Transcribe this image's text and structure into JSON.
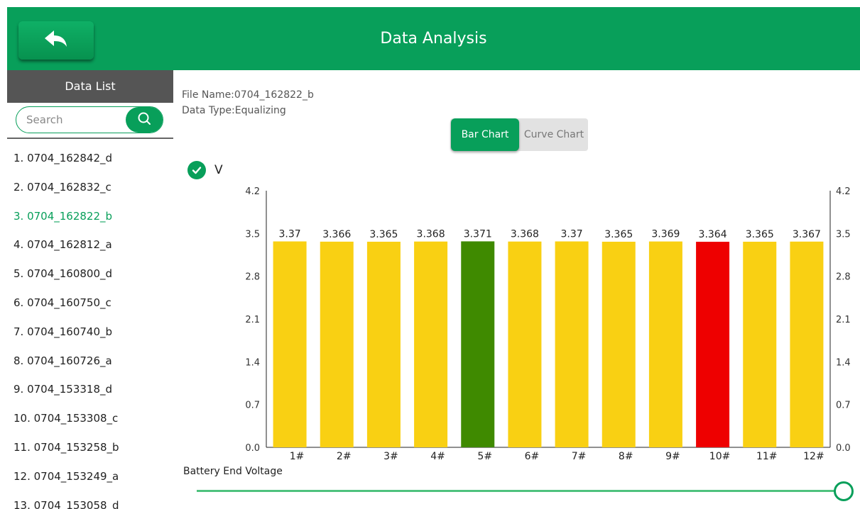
{
  "header": {
    "title": "Data Analysis",
    "back_icon": "back-arrow-icon"
  },
  "sidebar": {
    "title": "Data List",
    "search_placeholder": "Search",
    "items": [
      {
        "label": "1.  0704_162842_d",
        "selected": false
      },
      {
        "label": "2.  0704_162832_c",
        "selected": false
      },
      {
        "label": "3.  0704_162822_b",
        "selected": true
      },
      {
        "label": "4.  0704_162812_a",
        "selected": false
      },
      {
        "label": "5.  0704_160800_d",
        "selected": false
      },
      {
        "label": "6.  0704_160750_c",
        "selected": false
      },
      {
        "label": "7.  0704_160740_b",
        "selected": false
      },
      {
        "label": "8.  0704_160726_a",
        "selected": false
      },
      {
        "label": "9.  0704_153318_d",
        "selected": false
      },
      {
        "label": "10.  0704_153308_c",
        "selected": false
      },
      {
        "label": "11.  0704_153258_b",
        "selected": false
      },
      {
        "label": "12.  0704_153249_a",
        "selected": false
      },
      {
        "label": "13.  0704_153058_d",
        "selected": false
      }
    ]
  },
  "main": {
    "file_name": "File Name:0704_162822_b",
    "data_type": "Data Type:Equalizing",
    "tabs": {
      "bar": "Bar Chart",
      "curve": "Curve Chart",
      "active": "bar"
    },
    "legend_label": "V",
    "slider_label": "Battery End Voltage",
    "slider_value": 1.0
  },
  "colors": {
    "accent": "#089f5a",
    "bar_normal": "#f9d013",
    "bar_max": "#3f8a00",
    "bar_min": "#ee0000"
  },
  "chart_data": {
    "type": "bar",
    "categories": [
      "1#",
      "2#",
      "3#",
      "4#",
      "5#",
      "6#",
      "7#",
      "8#",
      "9#",
      "10#",
      "11#",
      "12#"
    ],
    "values": [
      3.37,
      3.366,
      3.365,
      3.368,
      3.371,
      3.368,
      3.37,
      3.365,
      3.369,
      3.364,
      3.365,
      3.367
    ],
    "value_labels": [
      "3.37",
      "3.366",
      "3.365",
      "3.368",
      "3.371",
      "3.368",
      "3.37",
      "3.365",
      "3.369",
      "3.364",
      "3.365",
      "3.367"
    ],
    "ylim": [
      0,
      4.2
    ],
    "yticks": [
      "0.0",
      "0.7",
      "1.4",
      "2.1",
      "2.8",
      "3.5",
      "4.2"
    ],
    "max_index": 4,
    "min_index": 9,
    "grid": false,
    "dual_y_axis": true
  }
}
